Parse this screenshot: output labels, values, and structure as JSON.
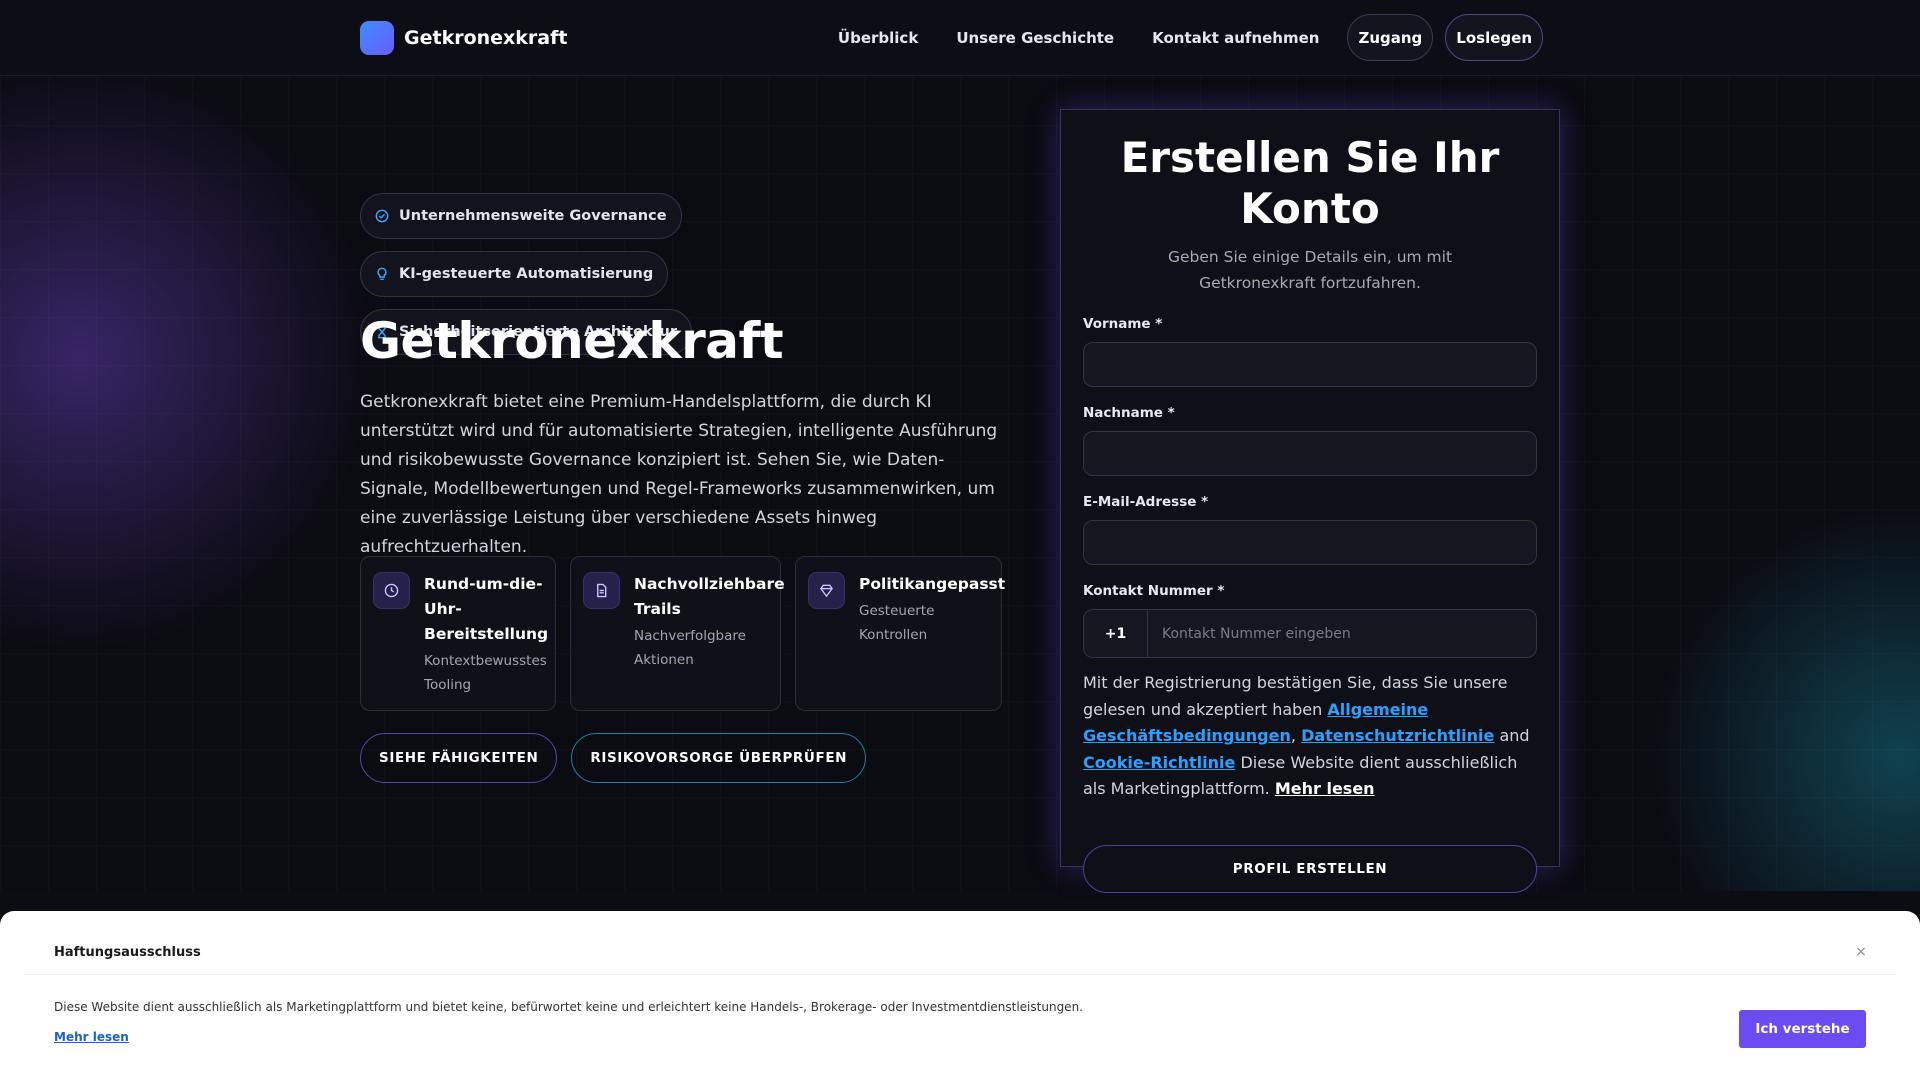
{
  "brand": {
    "name": "Getkronexkraft"
  },
  "nav": {
    "links": [
      "Überblick",
      "Unsere Geschichte",
      "Kontakt aufnehmen"
    ],
    "login": "Zugang",
    "cta": "Loslegen"
  },
  "hero": {
    "badges": [
      {
        "label": "Unternehmensweite Governance",
        "icon": "check-circle-icon"
      },
      {
        "label": "KI-gesteuerte Automatisierung",
        "icon": "lightbulb-icon"
      },
      {
        "label": "Sicherheitsorientierte Architektur",
        "icon": "hourglass-icon"
      }
    ],
    "title": "Getkronexkraft",
    "description": "Getkronexkraft bietet eine Premium-Handelsplattform, die durch KI unterstützt wird und für automatisierte Strategien, intelligente Ausführung und risikobewusste Governance konzipiert ist. Sehen Sie, wie Daten-Signale, Modellbewertungen und Regel-Frameworks zusammenwirken, um eine zuverlässige Leistung über verschiedene Assets hinweg aufrechtzuerhalten.",
    "features": [
      {
        "icon": "clock-icon",
        "title": "Rund-um-die-Uhr-Bereitstellung",
        "subtitle": "Kontextbewusstes Tooling"
      },
      {
        "icon": "document-icon",
        "title": "Nachvollziehbare Trails",
        "subtitle": "Nachverfolgbare Aktionen"
      },
      {
        "icon": "diamond-icon",
        "title": "Politikangepasst",
        "subtitle": "Gesteuerte Kontrollen"
      }
    ],
    "buttons": {
      "capabilities": "SIEHE FÄHIGKEITEN",
      "risk": "RISIKOVORSORGE ÜBERPRÜFEN"
    }
  },
  "form": {
    "title": "Erstellen Sie Ihr Konto",
    "subtitle": "Geben Sie einige Details ein, um mit Getkronexkraft fortzufahren.",
    "first_name_label": "Vorname *",
    "first_name_value": "",
    "last_name_label": "Nachname *",
    "last_name_value": "",
    "email_label": "E-Mail-Adresse *",
    "email_value": "",
    "phone_label": "Kontakt Nummer *",
    "phone_code": "+1",
    "phone_placeholder": "Kontakt Nummer eingeben",
    "consent": {
      "prefix": "Mit der Registrierung bestätigen Sie, dass Sie unsere gelesen und akzeptiert haben ",
      "terms_link": "Allgemeine Geschäftsbedingungen",
      "comma": ",",
      "privacy_link": "Datenschutzrichtlinie",
      "and": " and ",
      "cookie_link": "Cookie-Richtlinie",
      "suffix": " Diese Website dient ausschließlich als Marketingplattform. ",
      "more_link": "Mehr lesen"
    },
    "submit": "PROFIL ERSTELLEN"
  },
  "disclaimer": {
    "title": "Haftungsausschluss",
    "close": "×",
    "text": "Diese Website dient ausschließlich als Marketingplattform und bietet keine, befürwortet keine und erleichtert keine Handels-, Brokerage- oder Investmentdienstleistungen.",
    "more": "Mehr lesen",
    "button": "Ich verstehe"
  },
  "colors": {
    "accent_blue": "#2aa0ff",
    "accent_purple": "#6a4cf2",
    "background": "#0b0b12"
  }
}
